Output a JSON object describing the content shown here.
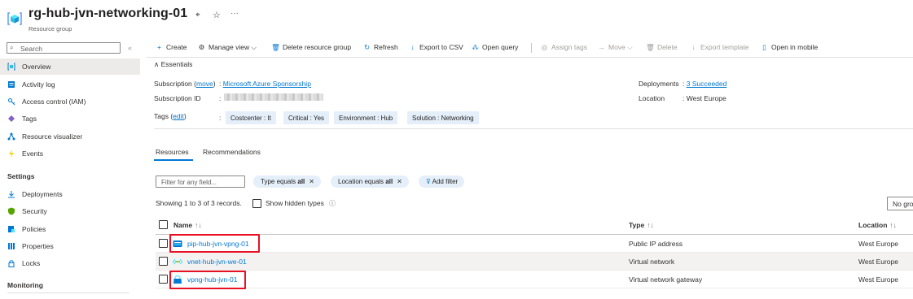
{
  "header": {
    "title": "rg-hub-jvn-networking-01",
    "subtitle": "Resource group",
    "pin_glyph": "⌖",
    "star_glyph": "☆",
    "more_glyph": "···"
  },
  "sidebar": {
    "search_placeholder": "Search",
    "collapse_glyph": "«",
    "items": [
      {
        "label": "Overview",
        "icon": "resource-group-icon",
        "active": true
      },
      {
        "label": "Activity log",
        "icon": "activity-log-icon"
      },
      {
        "label": "Access control (IAM)",
        "icon": "iam-icon"
      },
      {
        "label": "Tags",
        "icon": "tag-icon"
      },
      {
        "label": "Resource visualizer",
        "icon": "visualizer-icon"
      },
      {
        "label": "Events",
        "icon": "lightning-icon"
      }
    ],
    "settings_heading": "Settings",
    "settings_items": [
      {
        "label": "Deployments",
        "icon": "deployments-icon"
      },
      {
        "label": "Security",
        "icon": "shield-icon"
      },
      {
        "label": "Policies",
        "icon": "policies-icon"
      },
      {
        "label": "Properties",
        "icon": "properties-icon"
      },
      {
        "label": "Locks",
        "icon": "lock-icon"
      }
    ],
    "monitoring_heading": "Monitoring"
  },
  "toolbar": {
    "create": "Create",
    "manage_view": "Manage view",
    "delete_rg": "Delete resource group",
    "refresh": "Refresh",
    "export_csv": "Export to CSV",
    "open_query": "Open query",
    "assign_tags": "Assign tags",
    "move": "Move",
    "delete": "Delete",
    "export_template": "Export template",
    "open_mobile": "Open in mobile"
  },
  "essentials": {
    "toggle": "Essentials",
    "subscription_label": "Subscription",
    "move_link": "move",
    "subscription_value": "Microsoft Azure Sponsorship",
    "subscription_id_label": "Subscription ID",
    "tags_label": "Tags",
    "edit_link": "edit",
    "deployments_label": "Deployments",
    "deployments_value": "3 Succeeded",
    "location_label": "Location",
    "location_value": "West Europe",
    "tags": [
      "Costcenter : It",
      "Critical : Yes",
      "Environment : Hub",
      "Solution : Networking"
    ]
  },
  "tabs": [
    "Resources",
    "Recommendations"
  ],
  "filters": {
    "placeholder": "Filter for any field...",
    "type_prefix": "Type equals ",
    "type_value": "all",
    "location_prefix": "Location equals ",
    "location_value": "all",
    "add_filter": "Add filter"
  },
  "records_text": "Showing 1 to 3 of 3 records.",
  "show_hidden": "Show hidden types",
  "grouping": "No grouping",
  "table": {
    "headers": {
      "name": "Name",
      "type": "Type",
      "location": "Location"
    },
    "sort_name": "↑↓",
    "sort_type": "↑↓",
    "sort_location": "↑↓",
    "rows": [
      {
        "name": "pip-hub-jvn-vpng-01",
        "type": "Public IP address",
        "location": "West Europe",
        "icon": "public-ip-icon"
      },
      {
        "name": "vnet-hub-jvn-we-01",
        "type": "Virtual network",
        "location": "West Europe",
        "icon": "virtual-network-icon"
      },
      {
        "name": "vpng-hub-jvn-01",
        "type": "Virtual network gateway",
        "location": "West Europe",
        "icon": "vpn-gateway-icon"
      }
    ]
  },
  "colors": {
    "accent": "#0078d4",
    "highlight": "#e81123",
    "tag_bg": "#e5effa"
  }
}
